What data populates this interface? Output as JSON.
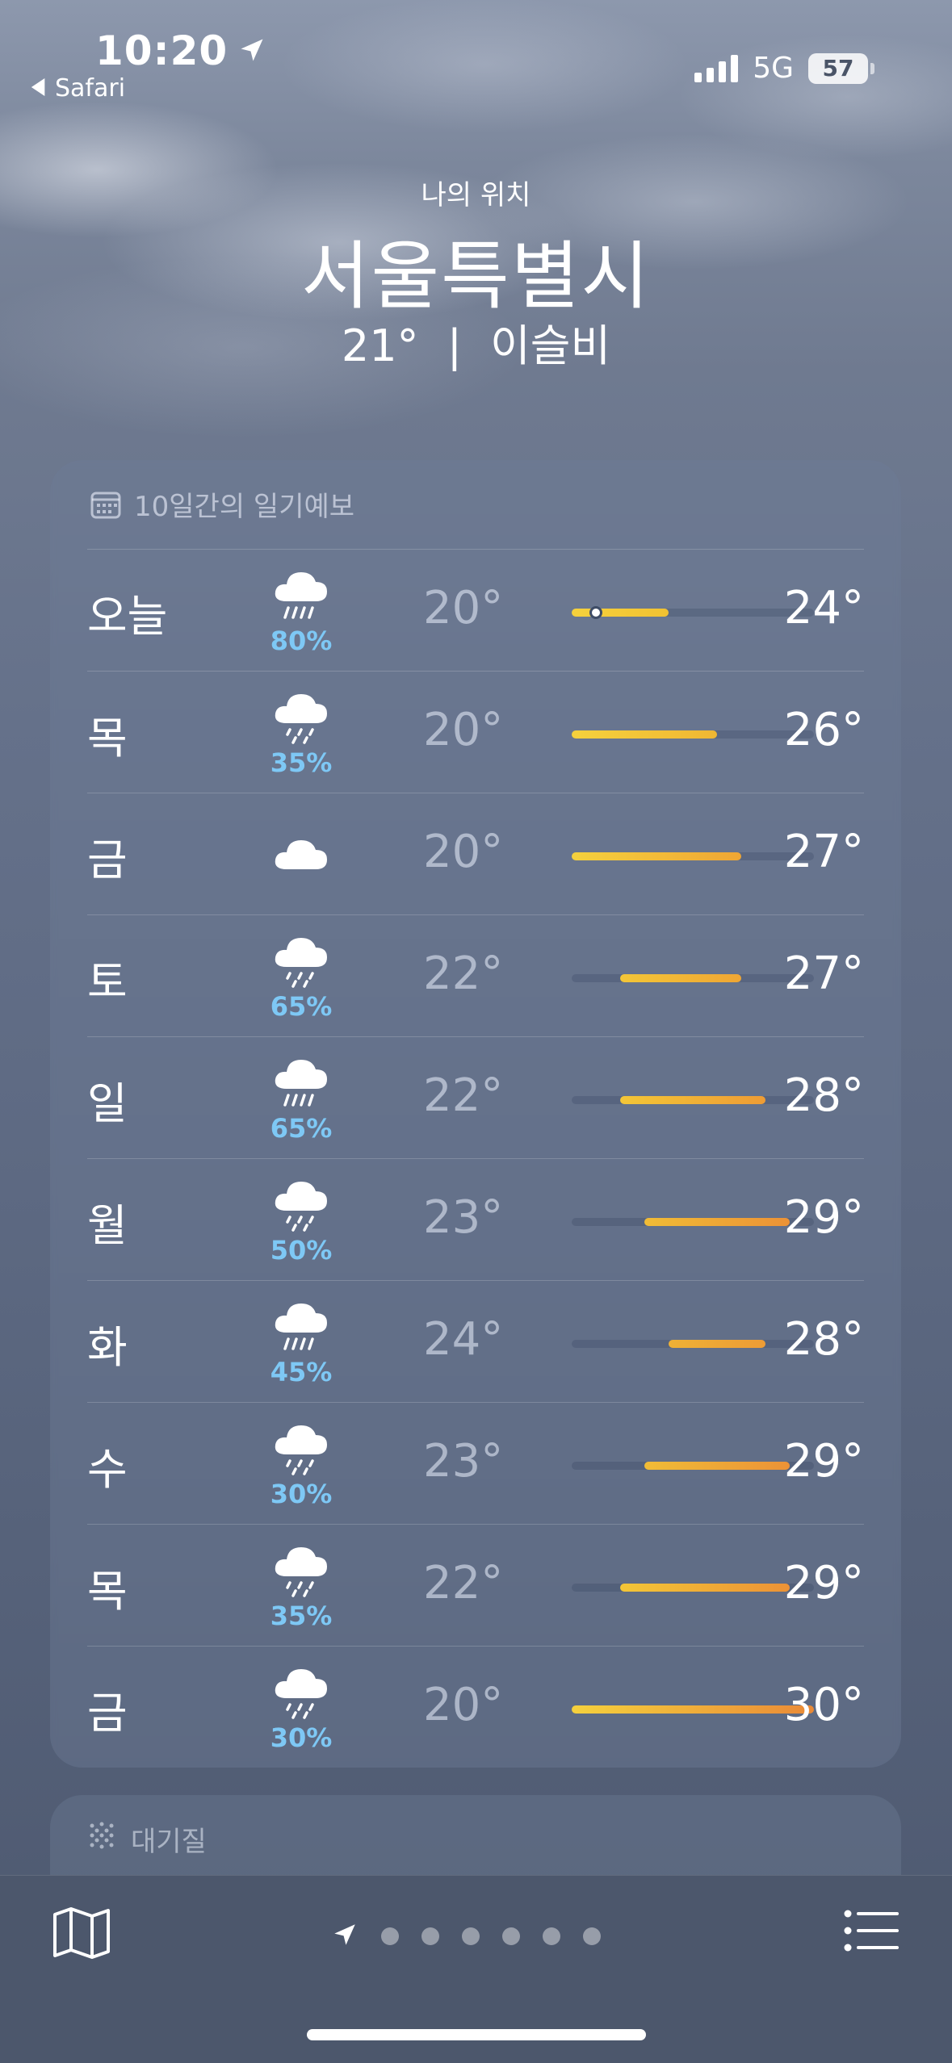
{
  "status_bar": {
    "time": "10:20",
    "back_label": "Safari",
    "network": "5G",
    "battery": "57"
  },
  "header": {
    "location_label": "나의 위치",
    "city": "서울특별시",
    "current_temp": "21°",
    "separator": "|",
    "condition": "이슬비"
  },
  "forecast": {
    "title": "10일간의 일기예보",
    "range_min": 20,
    "range_max": 30,
    "current_temp_value": 21,
    "days": [
      {
        "day": "오늘",
        "icon": "cloud-rain-heavy-icon",
        "precip": "80%",
        "low": "20°",
        "high": "24°",
        "low_v": 20,
        "high_v": 24,
        "show_dot": true,
        "colors": [
          "#f5d13d",
          "#f2c232"
        ]
      },
      {
        "day": "목",
        "icon": "cloud-rain-icon",
        "precip": "35%",
        "low": "20°",
        "high": "26°",
        "low_v": 20,
        "high_v": 26,
        "show_dot": false,
        "colors": [
          "#f5d13d",
          "#f0b733"
        ]
      },
      {
        "day": "금",
        "icon": "cloud-icon",
        "precip": "",
        "low": "20°",
        "high": "27°",
        "low_v": 20,
        "high_v": 27,
        "show_dot": false,
        "colors": [
          "#f5d13d",
          "#efa634"
        ]
      },
      {
        "day": "토",
        "icon": "cloud-rain-icon",
        "precip": "65%",
        "low": "22°",
        "high": "27°",
        "low_v": 22,
        "high_v": 27,
        "show_dot": false,
        "colors": [
          "#f3c637",
          "#efa634"
        ]
      },
      {
        "day": "일",
        "icon": "cloud-rain-heavy-icon",
        "precip": "65%",
        "low": "22°",
        "high": "28°",
        "low_v": 22,
        "high_v": 28,
        "show_dot": false,
        "colors": [
          "#f3c637",
          "#ee9c35"
        ]
      },
      {
        "day": "월",
        "icon": "cloud-rain-icon",
        "precip": "50%",
        "low": "23°",
        "high": "29°",
        "low_v": 23,
        "high_v": 29,
        "show_dot": false,
        "colors": [
          "#f1bc36",
          "#ec9236"
        ]
      },
      {
        "day": "화",
        "icon": "cloud-rain-heavy-icon",
        "precip": "45%",
        "low": "24°",
        "high": "28°",
        "low_v": 24,
        "high_v": 28,
        "show_dot": false,
        "colors": [
          "#efb135",
          "#ee9c35"
        ]
      },
      {
        "day": "수",
        "icon": "cloud-rain-icon",
        "precip": "30%",
        "low": "23°",
        "high": "29°",
        "low_v": 23,
        "high_v": 29,
        "show_dot": false,
        "colors": [
          "#f1bc36",
          "#ec9236"
        ]
      },
      {
        "day": "목",
        "icon": "cloud-rain-icon",
        "precip": "35%",
        "low": "22°",
        "high": "29°",
        "low_v": 22,
        "high_v": 29,
        "show_dot": false,
        "colors": [
          "#f3c637",
          "#ec9236"
        ]
      },
      {
        "day": "금",
        "icon": "cloud-rain-icon",
        "precip": "30%",
        "low": "20°",
        "high": "30°",
        "low_v": 20,
        "high_v": 30,
        "show_dot": false,
        "colors": [
          "#f5d13d",
          "#ea8a37"
        ]
      }
    ]
  },
  "air_quality": {
    "title": "대기질"
  },
  "bottom_bar": {
    "page_count": 6
  }
}
